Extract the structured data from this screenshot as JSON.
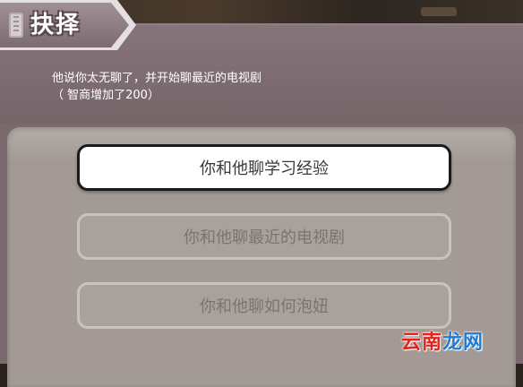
{
  "dialog": {
    "title": "抉择",
    "result_line1": "他说你太无聊了，并开始聊最近的电视剧",
    "result_line2": "（ 智商增加了200）"
  },
  "choices": [
    {
      "label": "你和他聊学习经验",
      "state": "selected"
    },
    {
      "label": "你和他聊最近的电视剧",
      "state": "disabled"
    },
    {
      "label": "你和他聊如何泡妞",
      "state": "disabled"
    }
  ],
  "watermark": {
    "part1": "云南",
    "part2": "龙网"
  },
  "colors": {
    "panel": "#7a6a6e",
    "options_bg": "#a39a95",
    "choice_active_bg": "#ffffff",
    "choice_active_border": "#1a1a1a",
    "choice_dim_bg": "#a8a29d",
    "watermark_red": "#e8201a",
    "watermark_blue": "#1e7bd6"
  }
}
